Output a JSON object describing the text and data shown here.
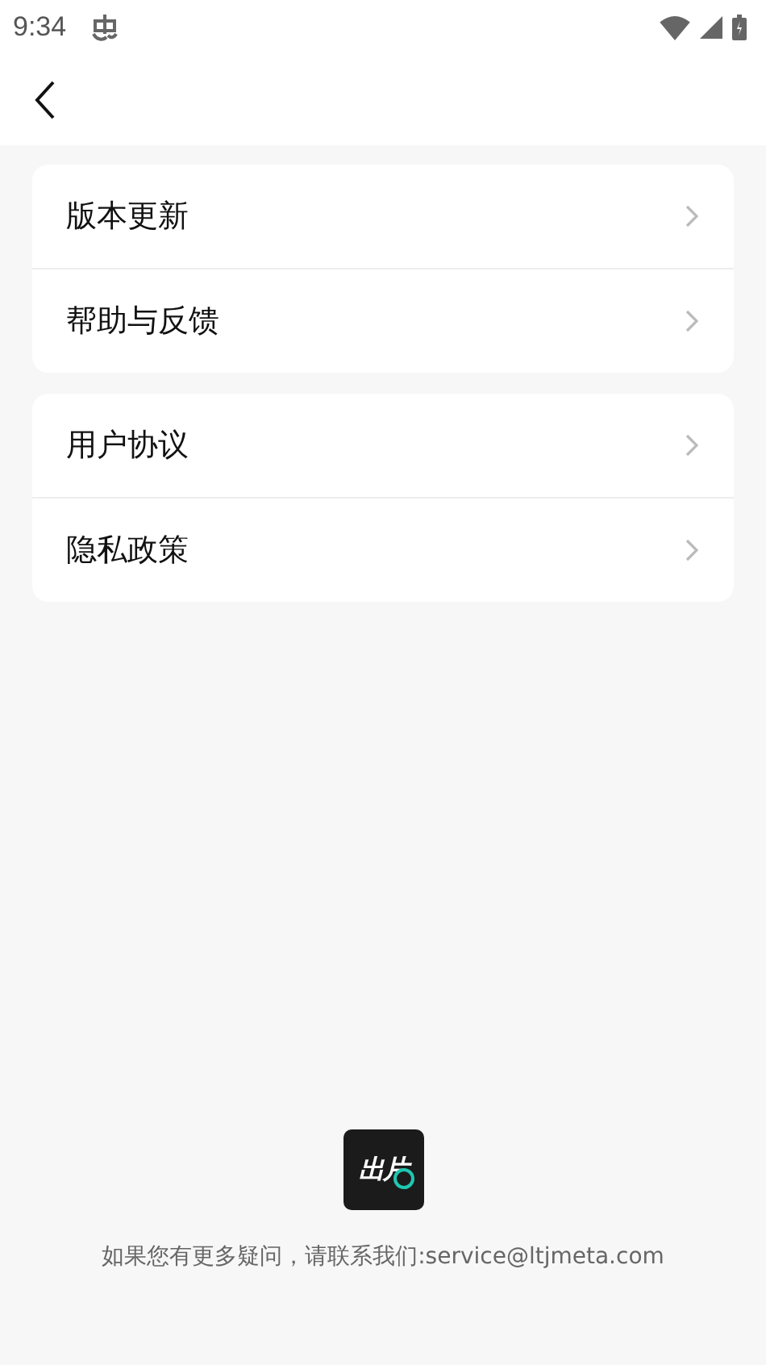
{
  "status_bar": {
    "time": "9:34"
  },
  "groups": [
    {
      "items": [
        {
          "label": "版本更新"
        },
        {
          "label": "帮助与反馈"
        }
      ]
    },
    {
      "items": [
        {
          "label": "用户协议"
        },
        {
          "label": "隐私政策"
        }
      ]
    }
  ],
  "footer": {
    "logo_text": "出片",
    "contact": "如果您有更多疑问，请联系我们:service@ltjmeta.com"
  }
}
